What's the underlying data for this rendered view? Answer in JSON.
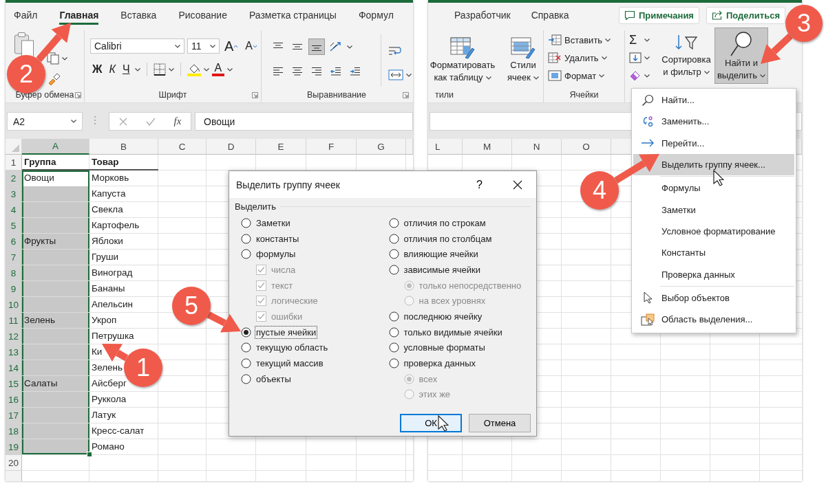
{
  "left_window": {
    "tabs": [
      {
        "label": "Файл",
        "selected": false
      },
      {
        "label": "Главная",
        "selected": true
      },
      {
        "label": "Вставка",
        "selected": false
      },
      {
        "label": "Рисование",
        "selected": false
      },
      {
        "label": "Разметка страницы",
        "selected": false
      },
      {
        "label": "Формул",
        "selected": false
      }
    ],
    "ribbon": {
      "font_name": "Calibri",
      "font_size": "11",
      "grow_font": "A",
      "shrink_font": "A",
      "bold": "Ж",
      "italic": "К",
      "underline": "Ч",
      "font_color": "A",
      "vertical_align": [
        {
          "selected": false
        },
        {
          "selected": false
        },
        {
          "selected": true
        }
      ],
      "groups": [
        "Буфер обмена",
        "Шрифт",
        "Выравнивание"
      ]
    },
    "name_box": "A2",
    "fx": "fx",
    "formula": "Овощи",
    "columns": [
      {
        "label": "A",
        "selected": true
      },
      {
        "label": "B",
        "selected": false
      },
      {
        "label": "C",
        "selected": false
      },
      {
        "label": "D",
        "selected": false
      },
      {
        "label": "E",
        "selected": false
      },
      {
        "label": "F",
        "selected": false
      },
      {
        "label": "G",
        "selected": false
      }
    ],
    "header_row": {
      "number": "1",
      "cells": [
        "Группа",
        "Товар"
      ]
    },
    "rows": [
      {
        "number": "2",
        "group": "Овощи",
        "item": "Морковь",
        "selected": true,
        "active": true
      },
      {
        "number": "3",
        "item": "Капуста",
        "selected": true,
        "active": false
      },
      {
        "number": "4",
        "item": "Свекла",
        "selected": true,
        "active": false
      },
      {
        "number": "5",
        "item": "Картофель",
        "selected": true,
        "active": false
      },
      {
        "number": "6",
        "group": "Фрукты",
        "item": "Яблоки",
        "selected": true,
        "active": false
      },
      {
        "number": "7",
        "item": "Груши",
        "selected": true,
        "active": false
      },
      {
        "number": "8",
        "item": "Виноград",
        "selected": true,
        "active": false
      },
      {
        "number": "9",
        "item": "Бананы",
        "selected": true,
        "active": false
      },
      {
        "number": "10",
        "item": "Апельсин",
        "selected": true,
        "active": false
      },
      {
        "number": "11",
        "group": "Зелень",
        "item": "Укроп",
        "selected": true,
        "active": false
      },
      {
        "number": "12",
        "item": "Петрушка",
        "selected": true,
        "active": false
      },
      {
        "number": "13",
        "item": "Ки",
        "selected": true,
        "active": false
      },
      {
        "number": "14",
        "item": "Зелень",
        "selected": true,
        "active": false
      },
      {
        "number": "15",
        "group": "Салаты",
        "item": "Айсберг",
        "selected": true,
        "active": false
      },
      {
        "number": "16",
        "item": "Руккола",
        "selected": true,
        "active": false
      },
      {
        "number": "17",
        "item": "Латук",
        "selected": true,
        "active": false
      },
      {
        "number": "18",
        "item": "Кресс-салат",
        "selected": true,
        "active": false
      },
      {
        "number": "19",
        "item": "Романо",
        "selected": true,
        "active": false
      },
      {
        "number": "20",
        "selected": false,
        "active": false
      }
    ]
  },
  "right_window": {
    "tabs": [
      {
        "label": "Разработчик",
        "selected": false
      },
      {
        "label": "Справка",
        "selected": false
      }
    ],
    "comments_button": "Примечания",
    "share_button": "Поделиться",
    "ribbon": {
      "format_table": [
        "Форматировать",
        "как таблицу"
      ],
      "cell_styles": [
        "Стили",
        "ячеек"
      ],
      "styles_group": "тили",
      "cell_commands": [
        "Вставить",
        "Удалить",
        "Формат"
      ],
      "cells_group": "Ячейки",
      "autosum": "Σ",
      "sort_filter": [
        "Сортировка",
        "и фильтр"
      ],
      "find_select": {
        "lines": [
          "Найти и",
          "выделить"
        ],
        "pressed": true
      }
    },
    "columns": [
      "L",
      "M",
      "N",
      "O"
    ]
  },
  "dialog": {
    "title": "Выделить группу ячеек",
    "help": "?",
    "group": "Выделить",
    "columns": [
      [
        {
          "kind": "radio",
          "label": "Заметки",
          "selected": false,
          "disabled": false
        },
        {
          "kind": "radio",
          "label": "константы",
          "selected": false,
          "disabled": false
        },
        {
          "kind": "radio",
          "label": "формулы",
          "selected": false,
          "disabled": false,
          "children": [
            {
              "kind": "checkbox",
              "label": "числа",
              "checked": true,
              "disabled": true
            },
            {
              "kind": "checkbox",
              "label": "текст",
              "checked": true,
              "disabled": true
            },
            {
              "kind": "checkbox",
              "label": "логические",
              "checked": true,
              "disabled": true
            },
            {
              "kind": "checkbox",
              "label": "ошибки",
              "checked": true,
              "disabled": true
            }
          ]
        },
        {
          "kind": "radio",
          "label": "пустые ячейки",
          "selected": true,
          "disabled": false
        },
        {
          "kind": "radio",
          "label": "текущую область",
          "selected": false,
          "disabled": false
        },
        {
          "kind": "radio",
          "label": "текущий массив",
          "selected": false,
          "disabled": false
        },
        {
          "kind": "radio",
          "label": "объекты",
          "selected": false,
          "disabled": false
        }
      ],
      [
        {
          "kind": "radio",
          "label": "отличия по строкам",
          "selected": false,
          "disabled": false
        },
        {
          "kind": "radio",
          "label": "отличия по столбцам",
          "selected": false,
          "disabled": false
        },
        {
          "kind": "radio",
          "label": "влияющие ячейки",
          "selected": false,
          "disabled": false
        },
        {
          "kind": "radio",
          "label": "зависимые ячейки",
          "selected": false,
          "disabled": false,
          "children": [
            {
              "kind": "radio",
              "label": "только непосредственно",
              "selected": true,
              "disabled": true
            },
            {
              "kind": "radio",
              "label": "на всех уровнях",
              "selected": false,
              "disabled": true
            }
          ]
        },
        {
          "kind": "radio",
          "label": "последнюю ячейку",
          "selected": false,
          "disabled": false
        },
        {
          "kind": "radio",
          "label": "только видимые ячейки",
          "selected": false,
          "disabled": false
        },
        {
          "kind": "radio",
          "label": "условные форматы",
          "selected": false,
          "disabled": false
        },
        {
          "kind": "radio",
          "label": "проверка данных",
          "selected": false,
          "disabled": false,
          "children": [
            {
              "kind": "radio",
              "label": "всех",
              "selected": true,
              "disabled": true
            },
            {
              "kind": "radio",
              "label": "этих же",
              "selected": false,
              "disabled": true
            }
          ]
        }
      ]
    ],
    "buttons": [
      {
        "label": "ОК",
        "default": true
      },
      {
        "label": "Отмена",
        "default": false
      }
    ]
  },
  "menu": {
    "items": [
      {
        "label": "Найти...",
        "highlighted": false,
        "separator_before": false
      },
      {
        "label": "Заменить...",
        "highlighted": false,
        "separator_before": false
      },
      {
        "label": "Перейти...",
        "highlighted": false,
        "separator_before": false
      },
      {
        "label": "Выделить группу ячеек...",
        "highlighted": true,
        "separator_before": false
      },
      {
        "label": "Формулы",
        "highlighted": false,
        "separator_before": true
      },
      {
        "label": "Заметки",
        "highlighted": false,
        "separator_before": false
      },
      {
        "label": "Условное форматирование",
        "highlighted": false,
        "separator_before": false
      },
      {
        "label": "Константы",
        "highlighted": false,
        "separator_before": false
      },
      {
        "label": "Проверка данных",
        "highlighted": false,
        "separator_before": false
      },
      {
        "label": "Выбор объектов",
        "highlighted": false,
        "separator_before": true
      },
      {
        "label": "Область выделения...",
        "highlighted": false,
        "separator_before": false
      }
    ]
  },
  "callouts": [
    {
      "number": "1"
    },
    {
      "number": "2"
    },
    {
      "number": "3"
    },
    {
      "number": "4"
    },
    {
      "number": "5"
    }
  ]
}
